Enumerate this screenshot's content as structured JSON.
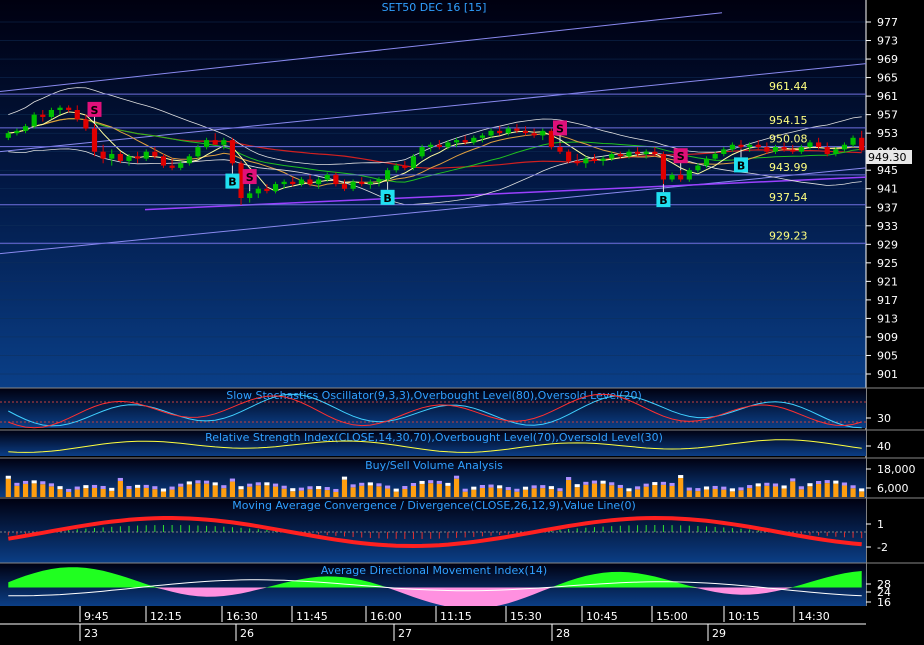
{
  "chart_data": {
    "title": "SET50 DEC 16   [15]",
    "last_price": "949.30",
    "type": "candlestick",
    "price_axis": {
      "ticks": [
        "977",
        "973",
        "969",
        "965",
        "961",
        "957",
        "953",
        "949",
        "945",
        "941",
        "937",
        "933",
        "929",
        "925",
        "921",
        "917",
        "913",
        "909",
        "905",
        "901"
      ],
      "range": [
        899,
        979
      ]
    },
    "levels": [
      {
        "label": "961.44",
        "value": 961.44
      },
      {
        "label": "954.15",
        "value": 954.15
      },
      {
        "label": "950.08",
        "value": 950.08
      },
      {
        "label": "943.99",
        "value": 943.99
      },
      {
        "label": "937.54",
        "value": 937.54
      },
      {
        "label": "929.23",
        "value": 929.23
      }
    ],
    "signals": [
      {
        "type": "S",
        "bar": 10
      },
      {
        "type": "S",
        "bar": 28
      },
      {
        "type": "S",
        "bar": 64
      },
      {
        "type": "S",
        "bar": 78
      },
      {
        "type": "B",
        "bar": 26
      },
      {
        "type": "B",
        "bar": 44
      },
      {
        "type": "B",
        "bar": 76
      },
      {
        "type": "B",
        "bar": 85
      }
    ],
    "ohlc": [
      [
        952.0,
        953.5,
        951.5,
        953.0
      ],
      [
        953.0,
        954.0,
        952.5,
        953.5
      ],
      [
        953.5,
        955.0,
        953.0,
        954.5
      ],
      [
        954.5,
        957.5,
        954.0,
        957.0
      ],
      [
        957.0,
        958.0,
        955.5,
        956.5
      ],
      [
        956.5,
        958.5,
        956.0,
        958.0
      ],
      [
        958.0,
        959.0,
        957.0,
        958.5
      ],
      [
        958.5,
        959.0,
        957.5,
        958.0
      ],
      [
        958.0,
        959.0,
        955.5,
        956.0
      ],
      [
        956.0,
        957.0,
        953.5,
        954.0
      ],
      [
        954.0,
        955.0,
        948.0,
        949.0
      ],
      [
        949.0,
        950.5,
        946.5,
        947.5
      ],
      [
        947.5,
        949.5,
        946.0,
        948.5
      ],
      [
        948.5,
        949.0,
        946.5,
        947.0
      ],
      [
        947.0,
        948.5,
        946.0,
        948.0
      ],
      [
        948.0,
        949.0,
        946.5,
        947.5
      ],
      [
        947.5,
        949.5,
        947.0,
        949.0
      ],
      [
        949.0,
        950.0,
        947.5,
        948.0
      ],
      [
        948.0,
        948.5,
        945.5,
        946.0
      ],
      [
        946.0,
        947.5,
        945.0,
        945.5
      ],
      [
        945.5,
        947.0,
        945.0,
        946.5
      ],
      [
        946.5,
        948.5,
        946.0,
        948.0
      ],
      [
        948.0,
        950.5,
        947.5,
        950.0
      ],
      [
        950.0,
        952.0,
        949.5,
        951.5
      ],
      [
        951.5,
        953.0,
        950.5,
        950.5
      ],
      [
        950.5,
        952.0,
        949.5,
        951.5
      ],
      [
        951.5,
        952.0,
        946.0,
        946.5
      ],
      [
        946.5,
        947.0,
        937.5,
        939.0
      ],
      [
        939.0,
        940.5,
        938.0,
        940.0
      ],
      [
        940.0,
        941.5,
        939.0,
        941.0
      ],
      [
        941.0,
        942.0,
        940.0,
        940.5
      ],
      [
        940.5,
        942.5,
        940.0,
        942.0
      ],
      [
        942.0,
        943.0,
        941.0,
        942.5
      ],
      [
        942.5,
        943.5,
        941.5,
        942.0
      ],
      [
        942.0,
        943.5,
        941.5,
        943.0
      ],
      [
        943.0,
        944.0,
        941.5,
        942.0
      ],
      [
        942.0,
        943.5,
        941.0,
        943.0
      ],
      [
        943.0,
        944.5,
        942.5,
        944.0
      ],
      [
        944.0,
        944.5,
        941.5,
        942.0
      ],
      [
        942.0,
        943.0,
        940.5,
        941.0
      ],
      [
        941.0,
        943.0,
        940.5,
        942.5
      ],
      [
        942.5,
        943.5,
        941.5,
        942.0
      ],
      [
        942.0,
        943.0,
        941.0,
        942.5
      ],
      [
        942.5,
        943.5,
        941.5,
        943.0
      ],
      [
        943.0,
        945.5,
        942.5,
        945.0
      ],
      [
        945.0,
        946.5,
        944.5,
        946.0
      ],
      [
        946.0,
        947.0,
        945.0,
        945.5
      ],
      [
        945.5,
        948.5,
        945.0,
        948.0
      ],
      [
        948.0,
        950.5,
        947.5,
        950.0
      ],
      [
        950.0,
        951.0,
        949.0,
        950.5
      ],
      [
        950.5,
        951.5,
        949.5,
        950.0
      ],
      [
        950.0,
        951.5,
        949.5,
        951.0
      ],
      [
        951.0,
        952.0,
        950.0,
        951.5
      ],
      [
        951.5,
        952.5,
        950.5,
        951.0
      ],
      [
        951.0,
        952.5,
        950.5,
        952.0
      ],
      [
        952.0,
        953.0,
        951.0,
        952.5
      ],
      [
        952.5,
        954.0,
        952.0,
        953.5
      ],
      [
        953.5,
        954.5,
        952.5,
        953.0
      ],
      [
        953.0,
        954.5,
        952.5,
        954.0
      ],
      [
        954.0,
        955.0,
        953.0,
        953.5
      ],
      [
        953.5,
        954.5,
        952.5,
        953.0
      ],
      [
        953.0,
        954.0,
        952.0,
        952.5
      ],
      [
        952.5,
        954.0,
        951.5,
        953.5
      ],
      [
        953.5,
        954.0,
        949.5,
        950.0
      ],
      [
        950.0,
        951.0,
        948.5,
        949.0
      ],
      [
        949.0,
        949.5,
        946.5,
        947.0
      ],
      [
        947.0,
        948.5,
        946.0,
        946.5
      ],
      [
        946.5,
        948.0,
        945.5,
        947.5
      ],
      [
        947.5,
        948.5,
        946.5,
        947.0
      ],
      [
        947.0,
        948.0,
        946.0,
        947.5
      ],
      [
        947.5,
        949.0,
        947.0,
        948.5
      ],
      [
        948.5,
        949.0,
        947.5,
        948.0
      ],
      [
        948.0,
        949.5,
        947.5,
        949.0
      ],
      [
        949.0,
        950.0,
        948.0,
        948.5
      ],
      [
        948.5,
        949.5,
        947.5,
        949.0
      ],
      [
        949.0,
        950.0,
        948.0,
        948.5
      ],
      [
        948.5,
        949.0,
        942.0,
        943.0
      ],
      [
        943.0,
        944.5,
        942.5,
        944.0
      ],
      [
        944.0,
        945.0,
        942.5,
        943.0
      ],
      [
        943.0,
        945.5,
        942.5,
        945.0
      ],
      [
        945.0,
        946.5,
        944.5,
        946.0
      ],
      [
        946.0,
        948.0,
        945.5,
        947.5
      ],
      [
        947.5,
        949.0,
        947.0,
        948.5
      ],
      [
        948.5,
        950.0,
        948.0,
        949.5
      ],
      [
        949.5,
        951.0,
        949.0,
        950.5
      ],
      [
        950.5,
        951.5,
        949.5,
        950.0
      ],
      [
        950.0,
        951.0,
        949.0,
        950.5
      ],
      [
        950.5,
        951.5,
        949.5,
        950.0
      ],
      [
        950.0,
        951.0,
        948.5,
        949.0
      ],
      [
        949.0,
        950.5,
        948.5,
        950.0
      ],
      [
        950.0,
        951.0,
        949.0,
        949.5
      ],
      [
        949.5,
        950.5,
        948.5,
        949.0
      ],
      [
        949.0,
        950.5,
        948.5,
        950.0
      ],
      [
        950.0,
        951.5,
        949.5,
        951.0
      ],
      [
        951.0,
        952.0,
        949.5,
        950.0
      ],
      [
        950.0,
        951.0,
        948.0,
        948.5
      ],
      [
        948.5,
        950.0,
        948.0,
        949.5
      ],
      [
        949.5,
        951.0,
        949.0,
        950.5
      ],
      [
        950.5,
        952.5,
        950.0,
        952.0
      ],
      [
        952.0,
        953.5,
        949.0,
        949.3
      ]
    ],
    "panels": [
      {
        "id": "stoch",
        "title": "Slow Stochastics Oscillator(9,3,3),Overbought Level(80),Oversold Level(20)",
        "ticks": [
          "30"
        ]
      },
      {
        "id": "rsi",
        "title": "Relative Strength Index(CLOSE,14,30,70),Overbought Level(70),Oversold Level(30)",
        "ticks": [
          "40"
        ]
      },
      {
        "id": "vol",
        "title": "Buy/Sell Volume Analysis",
        "ticks": [
          "18,000",
          "6,000"
        ]
      },
      {
        "id": "macd",
        "title": "Moving Average Convergence / Divergence(CLOSE,26,12,9),Value Line(0)",
        "ticks": [
          "1",
          "-2"
        ]
      },
      {
        "id": "adx",
        "title": "Average Directional Movement Index(14)",
        "ticks": [
          "28",
          "24",
          "16"
        ]
      }
    ],
    "time_labels": [
      "9:45",
      "12:15",
      "16:30",
      "11:45",
      "16:00",
      "11:15",
      "15:30",
      "10:45",
      "15:00",
      "10:15",
      "14:30"
    ],
    "date_labels": [
      "23",
      "26",
      "27",
      "28",
      "29"
    ],
    "grid": true
  },
  "colors": {
    "background_top": "#000010",
    "background_bottom": "#0a3a80",
    "up_candle": "#00c000",
    "down_candle": "#e00000",
    "axis_text": "#ffffff",
    "title_text": "#30a0ff",
    "level_text": "#ffff80",
    "sell_badge": "#e0107a",
    "buy_badge": "#20e0f0"
  }
}
